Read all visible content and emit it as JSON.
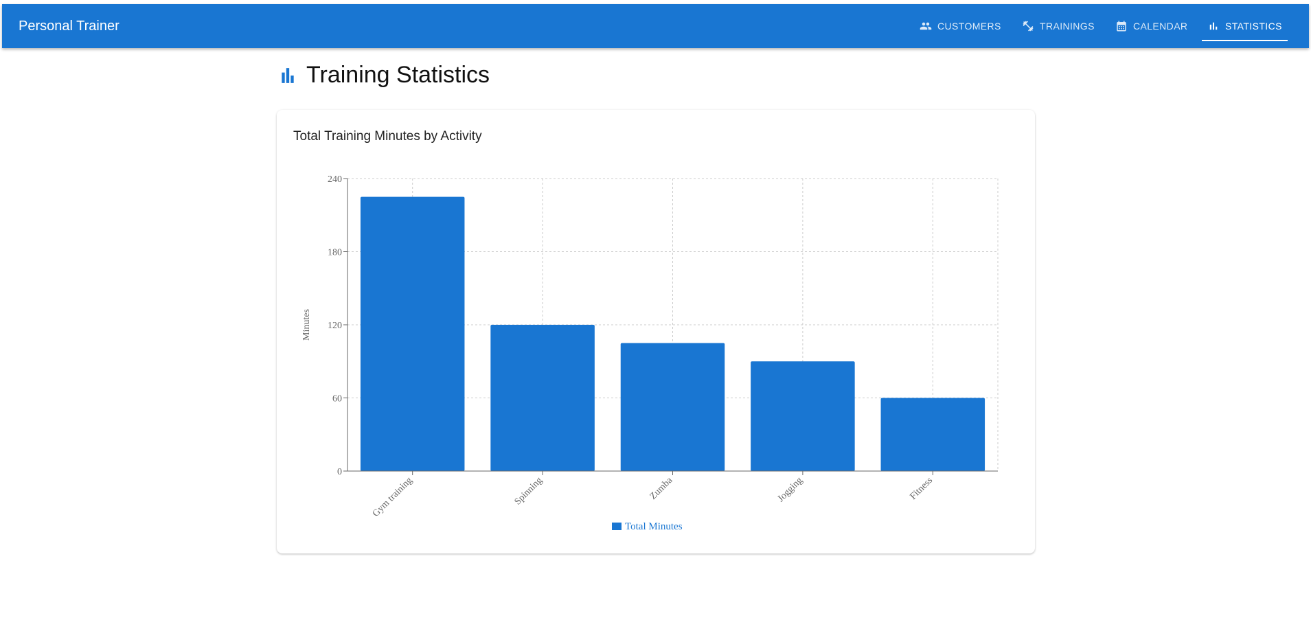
{
  "app": {
    "title": "Personal Trainer"
  },
  "nav": [
    {
      "label": "CUSTOMERS",
      "icon": "people-icon"
    },
    {
      "label": "TRAININGS",
      "icon": "fitness-icon"
    },
    {
      "label": "CALENDAR",
      "icon": "calendar-icon"
    },
    {
      "label": "STATISTICS",
      "icon": "bar-chart-icon",
      "active": true
    }
  ],
  "page": {
    "title": "Training Statistics",
    "icon": "bar-chart-icon"
  },
  "colors": {
    "primary": "#1976d2",
    "bar": "#1976d2",
    "grid": "#cccccc"
  },
  "chart_data": {
    "type": "bar",
    "title": "Total Training Minutes by Activity",
    "categories": [
      "Gym training",
      "Spinning",
      "Zumba",
      "Jogging",
      "Fitness"
    ],
    "series": [
      {
        "name": "Total Minutes",
        "values": [
          225,
          120,
          105,
          90,
          60
        ]
      }
    ],
    "xlabel": "",
    "ylabel": "Minutes",
    "ylim": [
      0,
      240
    ],
    "yticks": [
      0,
      60,
      120,
      180,
      240
    ],
    "grid": true,
    "legend": "bottom-center"
  }
}
